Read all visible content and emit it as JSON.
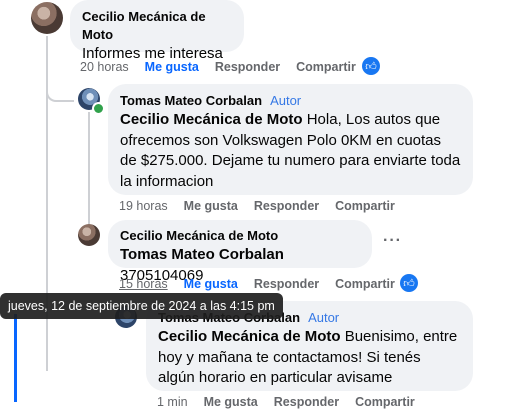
{
  "comments": [
    {
      "author": "Cecilio Mecánica de Moto",
      "badge": "",
      "mention": "",
      "text": "Informes me interesa",
      "time": "20 horas",
      "like": "Me gusta",
      "reply": "Responder",
      "share": "Compartir"
    },
    {
      "author": "Tomas Mateo Corbalan",
      "badge": "Autor",
      "mention": "Cecilio Mecánica de Moto",
      "text": " Hola, Los autos que ofrecemos son Volkswagen Polo 0KM en cuotas de $275.000. Dejame tu numero para enviarte toda la informacion",
      "time": "19 horas",
      "like": "Me gusta",
      "reply": "Responder",
      "share": "Compartir"
    },
    {
      "author": "Cecilio Mecánica de Moto",
      "badge": "",
      "mention": "Tomas Mateo Corbalan",
      "text": " 3705104069",
      "time": "15 horas",
      "like": "Me gusta",
      "reply": "Responder",
      "share": "Compartir"
    },
    {
      "author": "Tomas Mateo Corbalan",
      "badge": "Autor",
      "mention": "Cecilio Mecánica de Moto",
      "text": " Buenisimo, entre hoy y mañana te contactamos! Si tenés algún horario en particular avisame",
      "time": "1 min",
      "like": "Me gusta",
      "reply": "Responder",
      "share": "Compartir"
    }
  ],
  "tooltip": "jueves, 12 de septiembre de 2024 a las 4:15 pm",
  "more_options": "···",
  "icons": {
    "like_reaction": "thumbs-up-icon",
    "more": "more-options-icon"
  },
  "colors": {
    "accent": "#0866ff",
    "bubble": "#f0f2f5",
    "secondary_text": "#65676b",
    "online": "#31a24c"
  }
}
